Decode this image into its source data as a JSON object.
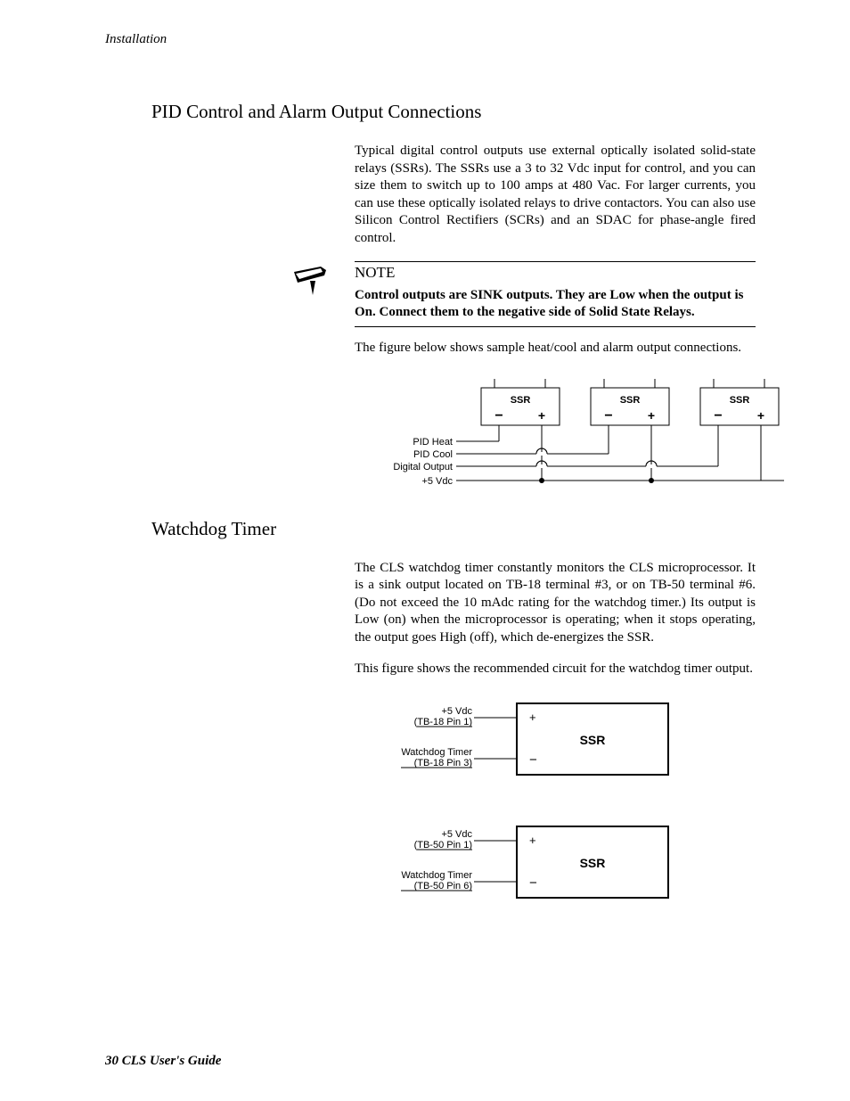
{
  "running_head": "Installation",
  "section1": {
    "title": "PID Control and Alarm Output Connections",
    "para1": "Typical digital control outputs use external optically isolated solid-state relays (SSRs). The SSRs use a 3 to 32 Vdc input for control, and you can size them to switch up to 100 amps at 480 Vac. For larger currents, you can use these optically isolated relays to drive contactors. You can also use Silicon Control Rectifiers (SCRs) and an SDAC for phase-angle fired control.",
    "note_label": "NOTE",
    "note_body": "Control outputs are SINK outputs. They are Low when the output is On. Connect them to the negative side of Solid State Relays.",
    "fig_caption": "The figure below shows sample heat/cool and alarm output connections."
  },
  "figure1": {
    "ssr_label": "SSR",
    "row_labels": [
      "PID Heat",
      "PID Cool",
      "Digital Output",
      "+5 Vdc"
    ],
    "minus": "−",
    "plus": "+"
  },
  "section2": {
    "title": "Watchdog Timer",
    "para1": "The CLS watchdog timer constantly monitors the CLS microprocessor. It is a sink output located on TB-18 terminal #3, or on TB-50 terminal #6. (Do not exceed the 10 mAdc rating for the watchdog timer.) Its output is Low (on) when the microprocessor is operating; when it stops operating, the output goes High (off), which de-energizes the SSR.",
    "para2": "This figure shows the recommended circuit for the watchdog timer output."
  },
  "figure2a": {
    "top_line1": "+5 Vdc",
    "top_line2": "(TB-18 Pin 1)",
    "bot_line1": "Watchdog Timer",
    "bot_line2": "(TB-18 Pin 3)",
    "ssr": "SSR",
    "plus": "+",
    "minus": "−"
  },
  "figure2b": {
    "top_line1": "+5 Vdc",
    "top_line2": "(TB-50 Pin 1)",
    "bot_line1": "Watchdog Timer",
    "bot_line2": "(TB-50 Pin 6)",
    "ssr": "SSR",
    "plus": "+",
    "minus": "−"
  },
  "footer": "30 CLS User's Guide"
}
